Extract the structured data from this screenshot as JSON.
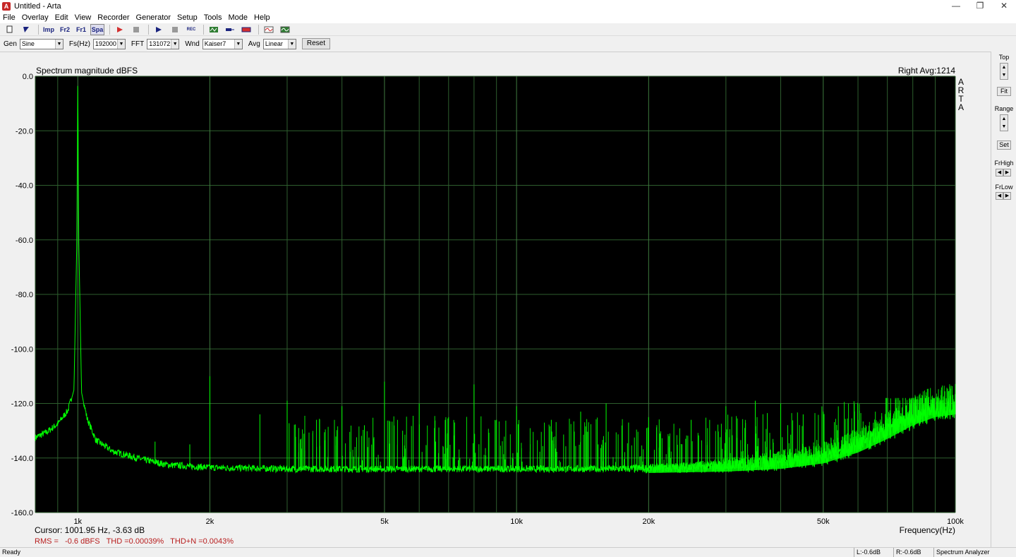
{
  "window": {
    "title": "Untitled - Arta",
    "icon": "arta-app-icon",
    "controls": [
      "minimize-icon",
      "restore-icon",
      "close-icon"
    ]
  },
  "menu": [
    "File",
    "Overlay",
    "Edit",
    "View",
    "Recorder",
    "Generator",
    "Setup",
    "Tools",
    "Mode",
    "Help"
  ],
  "toolbar": {
    "buttons": [
      {
        "name": "new-icon",
        "label": ""
      },
      {
        "name": "open-icon",
        "label": ""
      },
      {
        "name": "impulse-mode",
        "label": "Imp"
      },
      {
        "name": "freq-2ch-mode",
        "label": "Fr2"
      },
      {
        "name": "freq-1ch-mode",
        "label": "Fr1"
      },
      {
        "name": "spectrum-mode",
        "label": "Spa"
      },
      {
        "name": "record-icon",
        "label": ""
      },
      {
        "name": "stop-icon",
        "label": ""
      },
      {
        "name": "play-icon",
        "label": ""
      },
      {
        "name": "stop2-icon",
        "label": ""
      },
      {
        "name": "rec-icon",
        "label": "REC"
      },
      {
        "name": "generator-icon",
        "label": ""
      },
      {
        "name": "connector-icon",
        "label": ""
      },
      {
        "name": "card-icon",
        "label": ""
      },
      {
        "name": "scope-icon",
        "label": ""
      },
      {
        "name": "analyzer-icon",
        "label": ""
      }
    ],
    "accent_red": "#d32f2f",
    "accent_blue": "#1a237e"
  },
  "options": {
    "gen_label": "Gen",
    "gen_value": "Sine",
    "fs_label": "Fs(Hz)",
    "fs_value": "192000",
    "fft_label": "FFT",
    "fft_value": "131072",
    "wnd_label": "Wnd",
    "wnd_value": "Kaiser7",
    "avg_label": "Avg",
    "avg_value": "Linear",
    "reset_label": "Reset"
  },
  "right_panel": {
    "top_label": "Top",
    "fit_label": "Fit",
    "range_label": "Range",
    "set_label": "Set",
    "frhigh_label": "FrHigh",
    "frlow_label": "FrLow"
  },
  "plot": {
    "title": "Spectrum magnitude dBFS",
    "channel_info": "Right  Avg:1214",
    "logo": "ARTA",
    "cursor_text": "Cursor: 1001.95 Hz, -3.63 dB",
    "stats_text": "RMS =   -0.6 dBFS   THD =0.00039%   THD+N =0.0043%",
    "xaxis_title": "Frequency(Hz)",
    "background": "#000000",
    "trace_color": "#00ff00",
    "grid_color": "#2e5e2e"
  },
  "chart_data": {
    "type": "line",
    "title": "Spectrum magnitude dBFS",
    "xlabel": "Frequency(Hz)",
    "ylabel": "",
    "xscale": "log",
    "xlim": [
      800,
      100000
    ],
    "ylim": [
      -160,
      0
    ],
    "grid": true,
    "x_ticks": [
      {
        "value": 1000,
        "label": "1k"
      },
      {
        "value": 2000,
        "label": "2k"
      },
      {
        "value": 5000,
        "label": "5k"
      },
      {
        "value": 10000,
        "label": "10k"
      },
      {
        "value": 20000,
        "label": "20k"
      },
      {
        "value": 50000,
        "label": "50k"
      },
      {
        "value": 100000,
        "label": "100k"
      }
    ],
    "y_ticks": [
      {
        "value": 0,
        "label": "0.0"
      },
      {
        "value": -20,
        "label": "-20.0"
      },
      {
        "value": -40,
        "label": "-40.0"
      },
      {
        "value": -60,
        "label": "-60.0"
      },
      {
        "value": -80,
        "label": "-80.0"
      },
      {
        "value": -100,
        "label": "-100.0"
      },
      {
        "value": -120,
        "label": "-120.0"
      },
      {
        "value": -140,
        "label": "-140.0"
      },
      {
        "value": -160,
        "label": "-160.0"
      }
    ],
    "series": [
      {
        "name": "",
        "points": [
          [
            800,
            -133
          ],
          [
            850,
            -131
          ],
          [
            900,
            -128
          ],
          [
            950,
            -123
          ],
          [
            980,
            -115
          ],
          [
            995,
            -60
          ],
          [
            1000,
            0
          ],
          [
            1005,
            -60
          ],
          [
            1020,
            -116
          ],
          [
            1050,
            -126
          ],
          [
            1100,
            -134
          ],
          [
            1200,
            -138
          ],
          [
            1400,
            -141
          ],
          [
            1600,
            -143
          ],
          [
            2000,
            -144
          ],
          [
            3000,
            -144.5
          ],
          [
            5000,
            -144.5
          ],
          [
            10000,
            -144.5
          ],
          [
            20000,
            -144.5
          ],
          [
            30000,
            -144
          ],
          [
            40000,
            -143
          ],
          [
            50000,
            -141
          ],
          [
            60000,
            -137
          ],
          [
            70000,
            -132
          ],
          [
            80000,
            -127
          ],
          [
            90000,
            -124
          ],
          [
            100000,
            -123
          ]
        ]
      }
    ],
    "peaks": [
      [
        1000,
        0
      ],
      [
        1500,
        -134
      ],
      [
        1800,
        -135
      ],
      [
        2000,
        -110
      ],
      [
        2600,
        -124
      ],
      [
        3000,
        -119
      ],
      [
        3500,
        -126
      ],
      [
        4000,
        -121
      ],
      [
        4500,
        -128
      ],
      [
        5000,
        -112
      ],
      [
        5500,
        -130
      ],
      [
        6000,
        -120
      ],
      [
        6500,
        -129
      ],
      [
        7000,
        -125
      ],
      [
        8000,
        -113
      ],
      [
        9000,
        -126
      ],
      [
        10000,
        -121
      ],
      [
        12000,
        -126
      ],
      [
        14000,
        -123
      ],
      [
        16000,
        -120
      ],
      [
        18000,
        -127
      ],
      [
        20000,
        -125
      ],
      [
        25000,
        -126
      ],
      [
        30000,
        -121
      ],
      [
        35000,
        -119
      ],
      [
        40000,
        -120
      ],
      [
        45000,
        -124
      ],
      [
        50000,
        -123
      ],
      [
        60000,
        -126
      ],
      [
        70000,
        -125
      ],
      [
        80000,
        -124
      ]
    ]
  },
  "status": {
    "ready": "Ready",
    "left_level": "L:-0.6dB",
    "right_level": "R:-0.6dB",
    "mode": "Spectrum Analyzer"
  }
}
